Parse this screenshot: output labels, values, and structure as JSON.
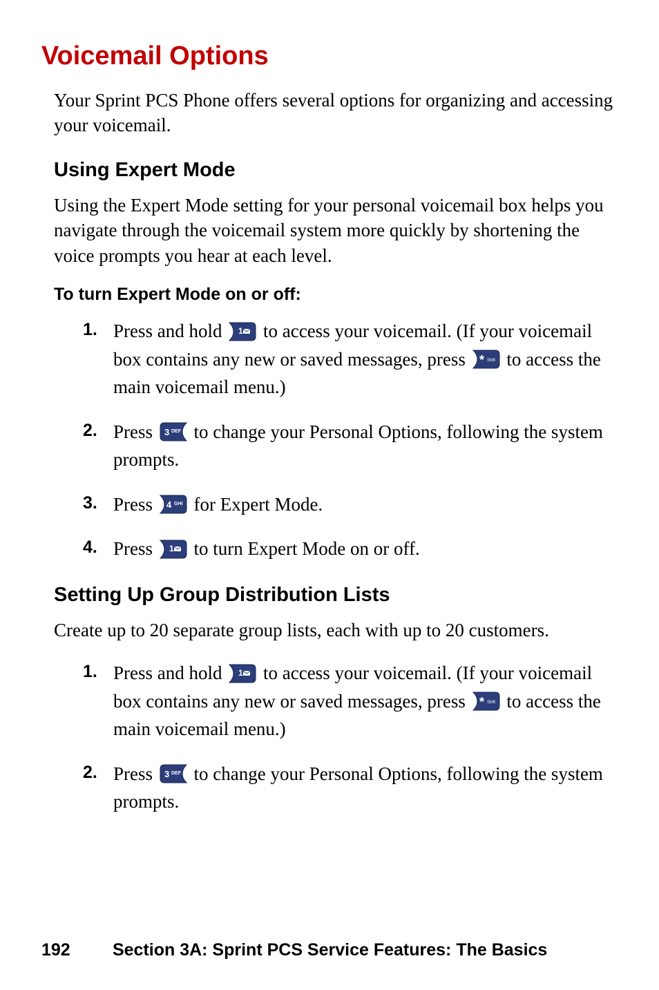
{
  "section_title": "Voicemail Options",
  "intro": "Your Sprint PCS Phone offers several options for organizing and accessing your voicemail.",
  "expert": {
    "heading": "Using Expert Mode",
    "desc": "Using the Expert Mode setting for your personal voicemail box helps you navigate through the voicemail system more quickly by shortening the voice prompts you hear at each level.",
    "subheading": "To turn Expert Mode on or off:",
    "step1_a": "Press and hold ",
    "step1_b": " to access your voicemail. (If your voicemail box contains any new or saved messages, press ",
    "step1_c": " to access the main voicemail menu.)",
    "step2_a": "Press ",
    "step2_b": " to change your Personal Options, following the system prompts.",
    "step3_a": "Press ",
    "step3_b": " for Expert Mode.",
    "step4_a": "Press ",
    "step4_b": " to turn Expert Mode on or off."
  },
  "groups": {
    "heading": "Setting Up Group Distribution Lists",
    "desc": "Create up to 20 separate group lists, each with up to 20 customers.",
    "step1_a": "Press and hold ",
    "step1_b": " to access your voicemail. (If your voicemail box contains any new or saved messages, press ",
    "step1_c": " to access the main voicemail menu.)",
    "step2_a": "Press ",
    "step2_b": " to change your Personal Options, following the system prompts."
  },
  "numbers": {
    "n1": "1.",
    "n2": "2.",
    "n3": "3.",
    "n4": "4."
  },
  "footer": {
    "page": "192",
    "section": "Section 3A: Sprint PCS Service Features: The Basics"
  },
  "icons": {
    "key1": "1-mail-key",
    "keystar": "star-shift-key",
    "key3": "3-def-key",
    "key4": "4-ghi-key"
  }
}
